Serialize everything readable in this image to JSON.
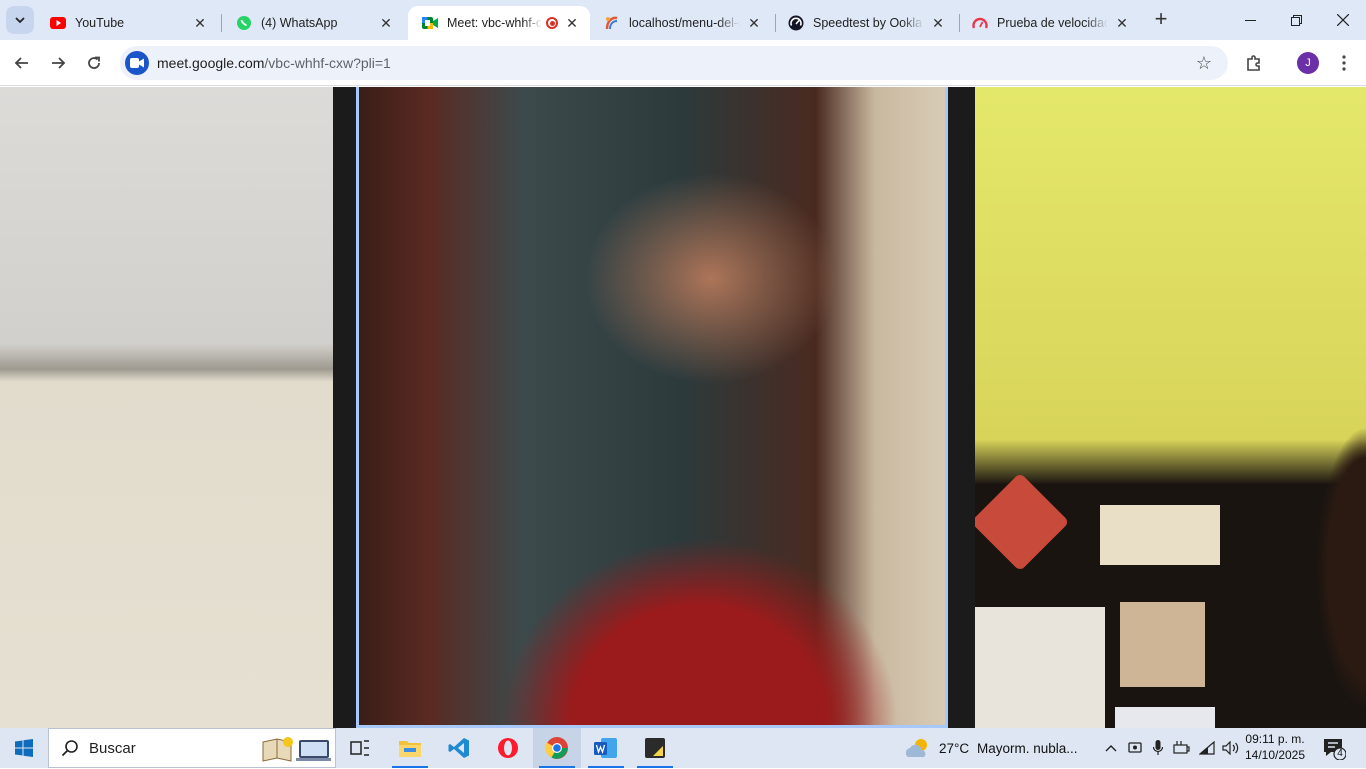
{
  "tabs": [
    {
      "title": "YouTube",
      "icon": "youtube-icon",
      "active": false
    },
    {
      "title": "(4) WhatsApp",
      "icon": "whatsapp-icon",
      "active": false
    },
    {
      "title": "Meet: vbc-whhf-cxw",
      "icon": "google-meet-icon",
      "active": true,
      "recording": true
    },
    {
      "title": "localhost/menu-del-dia",
      "icon": "localhost-icon",
      "active": false
    },
    {
      "title": "Speedtest by Ookla -",
      "icon": "speedtest-icon",
      "active": false
    },
    {
      "title": "Prueba de velocidad",
      "icon": "speed-gauge-icon",
      "active": false
    }
  ],
  "toolbar": {
    "url_host": "meet.google.com",
    "url_path": "/vbc-whhf-cxw?pli=1",
    "profile_initial": "J"
  },
  "taskbar": {
    "search_placeholder": "Buscar",
    "weather_temp": "27°C",
    "weather_desc": "Mayorm. nubla...",
    "time": "09:11 p. m.",
    "date": "14/10/2025",
    "notification_count": "4"
  },
  "colors": {
    "tabstrip_bg": "#dfe8f6",
    "omnibox_bg": "#edf2fa",
    "active_speaker_border": "#a8c7fa",
    "taskbar_bg": "#dde6f2",
    "record_red": "#d93025"
  }
}
